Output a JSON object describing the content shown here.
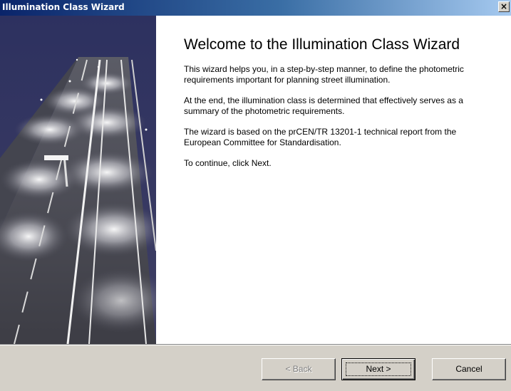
{
  "window": {
    "title": "Illumination Class Wizard",
    "close_glyph": "×"
  },
  "main": {
    "heading": "Welcome to the Illumination Class Wizard",
    "paragraphs": [
      "This wizard helps you, in a step-by-step manner, to define the photometric requirements important for planning street illumination.",
      "At the end, the illumination class is determined that effectively serves as a summary of the photometric requirements.",
      "The wizard is based on the prCEN/TR 13201-1 technical report from the European Committee for Standardisation.",
      "To continue, click Next."
    ],
    "image_description_icon": "street-lighting-image"
  },
  "buttons": {
    "back": "< Back",
    "next": "Next >",
    "cancel": "Cancel"
  },
  "colors": {
    "titlebar_start": "#0a246a",
    "titlebar_end": "#a6caf0",
    "dialog_bg": "#d4d0c8",
    "night_sky": "#34375e"
  }
}
